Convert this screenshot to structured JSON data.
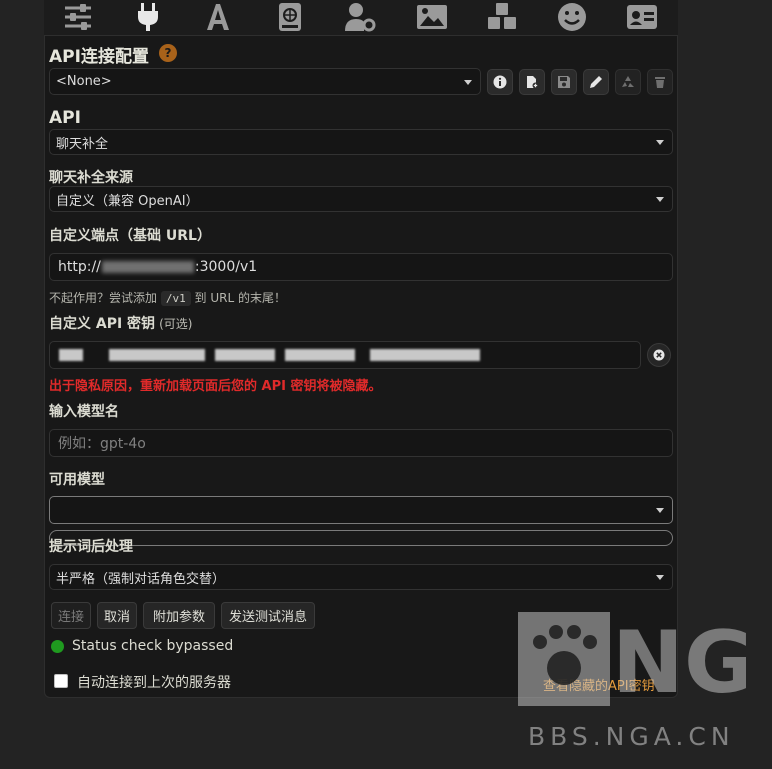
{
  "topbar": {
    "icons": [
      "sliders-icon",
      "plug-icon",
      "font-icon",
      "book-globe-icon",
      "user-gear-icon",
      "image-icon",
      "cubes-icon",
      "smile-icon",
      "id-card-icon"
    ],
    "active_icon": "plug-icon"
  },
  "connection": {
    "title": "API连接配置",
    "help": "?",
    "profile_value": "<None>"
  },
  "api": {
    "label": "API",
    "value": "聊天补全"
  },
  "source": {
    "label": "聊天补全来源",
    "value": "自定义（兼容 OpenAI）"
  },
  "endpoint": {
    "label": "自定义端点（基础 URL）",
    "value_start": "http://",
    "value_end": ":3000/v1",
    "hint_before": "不起作用？尝试添加",
    "hint_code": "/v1",
    "hint_after": "到 URL 的末尾！"
  },
  "api_key": {
    "label": "自定义 API 密钥",
    "optional": "(可选)",
    "warning": "出于隐私原因，重新加载页面后您的 API 密钥将被隐藏。"
  },
  "model_input": {
    "label": "输入模型名",
    "placeholder": "例如：gpt-4o"
  },
  "available_models": {
    "label": "可用模型",
    "value": ""
  },
  "post_processing": {
    "label": "提示词后处理",
    "value": "半严格（强制对话角色交替）"
  },
  "buttons": {
    "connect": "连接",
    "cancel": "取消",
    "extra_params": "附加参数",
    "send_test": "发送测试消息"
  },
  "status": {
    "text": "Status check bypassed",
    "color": "#1f9a1f"
  },
  "auto_connect": {
    "label": "自动连接到上次的服务器",
    "checked": false
  },
  "view_hidden_keys": "查看隐藏的API密钥",
  "watermark": {
    "logo": "NGA",
    "domain": "BBS.NGA.CN"
  },
  "colors": {
    "accent_orange": "#e39a3c",
    "warning_red": "#e02a2a",
    "help_badge": "#a8621a"
  }
}
